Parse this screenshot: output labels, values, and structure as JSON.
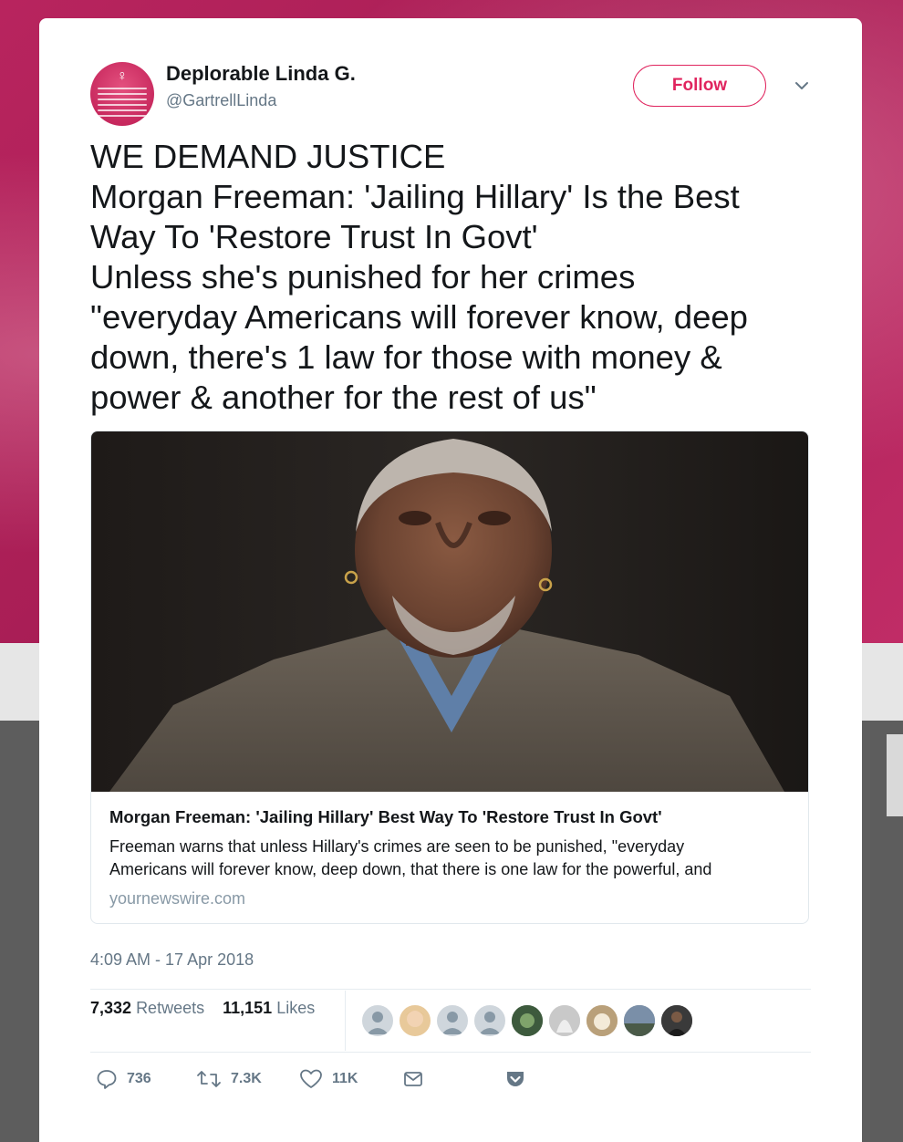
{
  "author": {
    "name": "Deplorable Linda G.",
    "handle": "@GartrellLinda",
    "avatar_icon": "venus-symbol-icon"
  },
  "follow_label": "Follow",
  "tweet_lines": [
    "WE DEMAND JUSTICE",
    "Morgan Freeman: 'Jailing Hillary' Is the Best",
    "Way To 'Restore Trust In Govt'",
    "Unless she's punished for her crimes",
    "\"everyday Americans will forever know, deep",
    "down, there's 1 law for those with money &",
    "power & another for the rest of us\""
  ],
  "link_card": {
    "title": "Morgan Freeman: 'Jailing Hillary' Best Way To 'Restore Trust In Govt'",
    "description_lines": [
      "Freeman warns that unless Hillary's crimes are seen to be punished, \"everyday",
      "Americans will forever know, deep down, that there is one law for the powerful, and"
    ],
    "domain": "yournewswire.com"
  },
  "timestamp": "4:09 AM - 17 Apr 2018",
  "stats": {
    "retweets_count": "7,332",
    "retweets_label": "Retweets",
    "likes_count": "11,151",
    "likes_label": "Likes"
  },
  "actions": {
    "replies": "736",
    "retweets": "7.3K",
    "likes": "11K"
  },
  "colors": {
    "accent": "#e0245e",
    "text": "#14171a",
    "muted": "#657786",
    "background_magenta": "#b8245e"
  }
}
